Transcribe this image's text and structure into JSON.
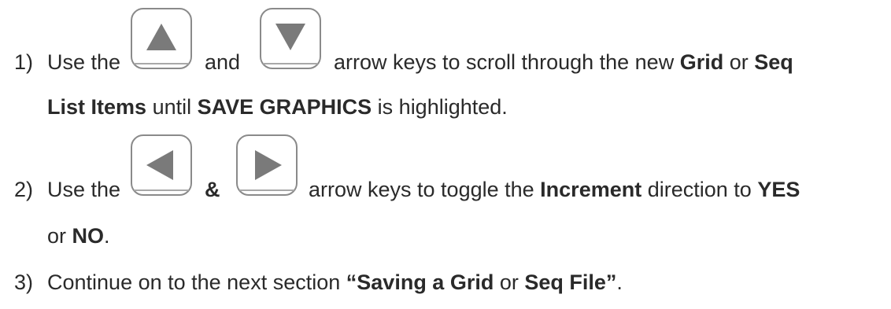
{
  "steps": [
    {
      "number": "1)",
      "use_the": "Use the",
      "connector": "and",
      "after_keys": "arrow keys to scroll through the new",
      "grid": "Grid",
      "or1": "or",
      "seq": "Seq",
      "list_items": "List Items",
      "until": "until",
      "save_graphics": "SAVE GRAPHICS",
      "tail": "is highlighted.",
      "key_a": "up-arrow-icon",
      "key_b": "down-arrow-icon"
    },
    {
      "number": "2)",
      "use_the": "Use the",
      "connector": "&",
      "after_keys": "arrow keys to toggle the",
      "increment": "Increment",
      "direction_to": "direction to",
      "yes": "YES",
      "or": "or",
      "no": "NO",
      "period": ".",
      "key_a": "left-arrow-icon",
      "key_b": "right-arrow-icon"
    },
    {
      "number": "3)",
      "text": "Continue on to the next section",
      "quote_part1": "“Saving a Grid",
      "or": "or",
      "quote_part2": "Seq File”",
      "period": "."
    }
  ],
  "colors": {
    "text": "#2a2a2a",
    "key_border": "#8a8a8a",
    "arrow_fill": "#7a7a7a"
  }
}
